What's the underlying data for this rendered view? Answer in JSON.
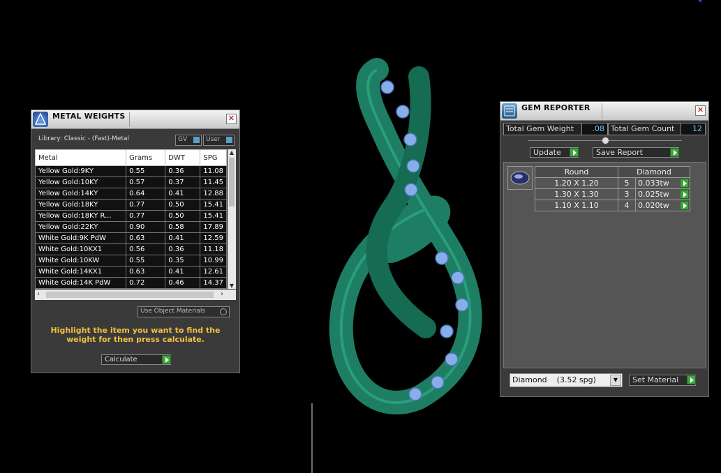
{
  "metal_weights": {
    "title": "METAL WEIGHTS",
    "library_label": "Library: Classic - (Fast)-Metal",
    "toggle_gv": "GV",
    "toggle_user": "User",
    "columns": [
      "Metal",
      "Grams",
      "DWT",
      "SPG"
    ],
    "rows": [
      {
        "metal": "Yellow Gold:9KY",
        "grams": "0.55",
        "dwt": "0.36",
        "spg": "11.08"
      },
      {
        "metal": "Yellow Gold:10KY",
        "grams": "0.57",
        "dwt": "0.37",
        "spg": "11.45"
      },
      {
        "metal": "Yellow Gold:14KY",
        "grams": "0.64",
        "dwt": "0.41",
        "spg": "12.88"
      },
      {
        "metal": "Yellow Gold:18KY",
        "grams": "0.77",
        "dwt": "0.50",
        "spg": "15.41"
      },
      {
        "metal": "Yellow Gold:18KY R...",
        "grams": "0.77",
        "dwt": "0.50",
        "spg": "15.41"
      },
      {
        "metal": "Yellow Gold:22KY",
        "grams": "0.90",
        "dwt": "0.58",
        "spg": "17.89"
      },
      {
        "metal": "White Gold:9K PdW",
        "grams": "0.63",
        "dwt": "0.41",
        "spg": "12.59"
      },
      {
        "metal": "White Gold:10KX1",
        "grams": "0.56",
        "dwt": "0.36",
        "spg": "11.18"
      },
      {
        "metal": "White Gold:10KW",
        "grams": "0.55",
        "dwt": "0.35",
        "spg": "10.99"
      },
      {
        "metal": "White Gold:14KX1",
        "grams": "0.63",
        "dwt": "0.41",
        "spg": "12.61"
      },
      {
        "metal": "White Gold:14K PdW",
        "grams": "0.72",
        "dwt": "0.46",
        "spg": "14.37"
      }
    ],
    "use_object_materials": "Use Object Materials",
    "instruction": "Highlight the item you want to find the weight for then press calculate.",
    "calculate_label": "Calculate"
  },
  "gem_reporter": {
    "title": "GEM REPORTER",
    "total_weight_label": "Total Gem Weight",
    "total_weight_value": ".08",
    "total_count_label": "Total Gem Count",
    "total_count_value": "12",
    "update_label": "Update",
    "save_report_label": "Save Report",
    "header_cut": "Round",
    "header_material": "Diamond",
    "rows": [
      {
        "size": "1.20 X 1.20",
        "count": "5",
        "weight": "0.033tw"
      },
      {
        "size": "1.30 X 1.30",
        "count": "3",
        "weight": "0.025tw"
      },
      {
        "size": "1.10 X 1.10",
        "count": "4",
        "weight": "0.020tw"
      }
    ],
    "material_select": "Diamond    (3.52 spg)",
    "set_material_label": "Set Material"
  },
  "colors": {
    "ring": "#1f8a6a",
    "gem": "#7fa8e8",
    "accent": "#f0c040"
  }
}
